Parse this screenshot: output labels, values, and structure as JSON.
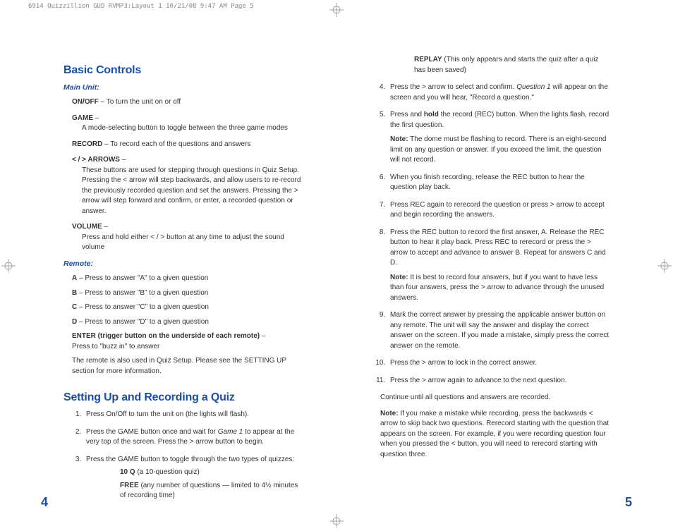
{
  "header_strip": "6914 Quizzillion GUD RVMP3:Layout 1  10/21/08  9:47 AM  Page 5",
  "left": {
    "h1a": "Basic Controls",
    "sub_main": "Main Unit:",
    "main_defs": [
      {
        "term": "ON/OFF",
        "dash": " – ",
        "body": "To turn the unit on or off"
      },
      {
        "term": "GAME",
        "dash": " – ",
        "body": "A mode-selecting button to toggle between the three game modes"
      },
      {
        "term": "RECORD",
        "dash": " – ",
        "body": "To record each of the questions and answers"
      },
      {
        "term": "< / > ARROWS",
        "dash": " – ",
        "body": "These buttons are used for stepping through questions in Quiz Setup. Pressing the < arrow will step backwards, and allow users to re-record the previously recorded question and set the answers. Pressing the > arrow will step forward and confirm, or enter, a recorded question or answer."
      },
      {
        "term": "VOLUME",
        "dash": " – ",
        "body": "Press and hold either < / > button at any time to adjust the sound volume"
      }
    ],
    "sub_remote": "Remote:",
    "remote_defs": [
      {
        "term": "A",
        "dash": " – ",
        "body": "Press to answer \"A\" to a given question"
      },
      {
        "term": "B",
        "dash": " – ",
        "body": " Press to answer \"B\" to a given question"
      },
      {
        "term": "C",
        "dash": " – ",
        "body": " Press to answer \"C\" to a given question"
      },
      {
        "term": "D",
        "dash": " – ",
        "body": " Press to answer \"D\" to a given question"
      }
    ],
    "enter_term": "ENTER (trigger button on the underside of each remote)",
    "enter_dash": " – ",
    "enter_body": "Press to \"buzz in\" to answer",
    "remote_note": "The remote is also used in Quiz Setup. Please see the SETTING UP section for more information.",
    "h1b": "Setting Up and Recording a Quiz",
    "steps": [
      {
        "text": "Press On/Off to turn the unit on (the lights will flash)."
      },
      {
        "pre": "Press the GAME button once and wait for ",
        "ital": "Game 1",
        "post": " to appear at the very top of the screen. Press the > arrow button to begin."
      },
      {
        "text": "Press the GAME button to toggle through the two types of quizzes:",
        "sub1_b": "10 Q",
        "sub1_t": " (a 10-question quiz)",
        "sub2_b": "FREE",
        "sub2_t": " (any number of questions — limited to 4½ minutes of recording time)"
      }
    ],
    "pgnum": "4"
  },
  "right": {
    "replay_b": "REPLAY",
    "replay_t": " (This only appears and starts the quiz after a quiz has been saved)",
    "steps": [
      {
        "n": "4",
        "pre": "Press the > arrow to select and confirm. ",
        "ital": "Question 1",
        "post": " will appear on the screen and you will hear, \"Record a question.\""
      },
      {
        "n": "5",
        "pre": "Press and ",
        "bold": "hold",
        "post": " the record (REC) button. When the lights flash, record the first question.",
        "note_b": "Note:",
        "note_t": " The dome must be flashing to record. There is an eight-second limit on any question or answer. If you exceed the limit, the question will not record."
      },
      {
        "n": "6",
        "text": "When you finish recording, release the REC button to hear the question play back."
      },
      {
        "n": "7",
        "text": "Press REC again to rerecord the question or press > arrow to accept and begin recording the answers."
      },
      {
        "n": "8",
        "text": "Press the REC button to record the first answer, A. Release the REC button to hear it play back. Press REC to rerecord or press the > arrow to accept and advance to answer B. Repeat for answers C and D.",
        "note_b": "Note:",
        "note_t": " It is best to record four answers, but if you want to have less than four answers, press the > arrow to advance through the unused answers."
      },
      {
        "n": "9",
        "text": "Mark the correct answer by pressing the applicable answer button on any remote. The unit will say the answer and display the correct answer on the screen. If you made a mistake, simply press the correct answer on the remote."
      },
      {
        "n": "10",
        "text": "Press the > arrow to lock in the correct answer."
      },
      {
        "n": "11",
        "text": "Press the > arrow again to advance to the next question."
      }
    ],
    "continue": "Continue until all questions and answers are recorded.",
    "final_b": "Note:",
    "final_t": "  If you make a mistake while recording, press the backwards < arrow to skip back two questions. Rerecord starting with the question that appears on the screen. For example, if you were recording question four when you pressed the < button, you will need to rerecord starting with question three.",
    "pgnum": "5"
  }
}
